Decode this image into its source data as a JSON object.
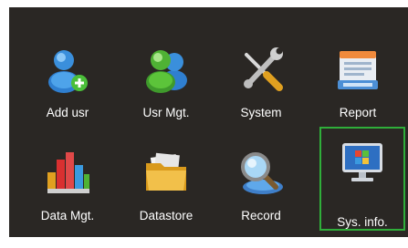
{
  "menu": {
    "items": [
      {
        "label": "Add usr",
        "icon": "add-user-icon"
      },
      {
        "label": "Usr Mgt.",
        "icon": "users-icon"
      },
      {
        "label": "System",
        "icon": "tools-icon"
      },
      {
        "label": "Report",
        "icon": "report-icon"
      },
      {
        "label": "Data Mgt.",
        "icon": "bar-chart-icon"
      },
      {
        "label": "Datastore",
        "icon": "folder-icon"
      },
      {
        "label": "Record",
        "icon": "magnifier-icon"
      },
      {
        "label": "Sys. info.",
        "icon": "monitor-icon",
        "selected": true
      }
    ],
    "selection_color": "#2fae3a",
    "background_color": "#2a2724"
  }
}
